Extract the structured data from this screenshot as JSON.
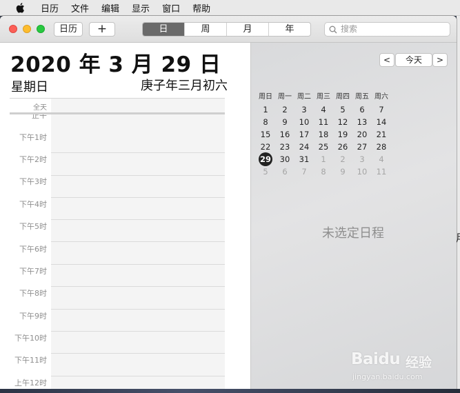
{
  "menubar": {
    "items": [
      "日历",
      "文件",
      "编辑",
      "显示",
      "窗口",
      "帮助"
    ]
  },
  "toolbar": {
    "calendars_label": "日历",
    "add_label": "+",
    "views": [
      {
        "label": "日",
        "active": true
      },
      {
        "label": "周",
        "active": false
      },
      {
        "label": "月",
        "active": false
      },
      {
        "label": "年",
        "active": false
      }
    ],
    "search_placeholder": "搜索"
  },
  "dayview": {
    "date_title": "2020 年 3 月 29 日",
    "weekday": "星期日",
    "lunar_date": "庚子年三月初六",
    "allday_label": "全天",
    "partial_label": "正午",
    "hours": [
      "下午1时",
      "下午2时",
      "下午3时",
      "下午4时",
      "下午5时",
      "下午6时",
      "下午7时",
      "下午8时",
      "下午9时",
      "下午10时",
      "下午11时",
      "上午12时"
    ]
  },
  "sidebar": {
    "prev_label": "<",
    "today_label": "今天",
    "next_label": ">",
    "weekday_headers": [
      "周日",
      "周一",
      "周二",
      "周三",
      "周四",
      "周五",
      "周六"
    ],
    "weeks": [
      [
        {
          "d": "1",
          "dim": false
        },
        {
          "d": "2",
          "dim": false
        },
        {
          "d": "3",
          "dim": false
        },
        {
          "d": "4",
          "dim": false
        },
        {
          "d": "5",
          "dim": false
        },
        {
          "d": "6",
          "dim": false
        },
        {
          "d": "7",
          "dim": false
        }
      ],
      [
        {
          "d": "8",
          "dim": false
        },
        {
          "d": "9",
          "dim": false
        },
        {
          "d": "10",
          "dim": false
        },
        {
          "d": "11",
          "dim": false
        },
        {
          "d": "12",
          "dim": false
        },
        {
          "d": "13",
          "dim": false
        },
        {
          "d": "14",
          "dim": false
        }
      ],
      [
        {
          "d": "15",
          "dim": false
        },
        {
          "d": "16",
          "dim": false
        },
        {
          "d": "17",
          "dim": false
        },
        {
          "d": "18",
          "dim": false
        },
        {
          "d": "19",
          "dim": false
        },
        {
          "d": "20",
          "dim": false
        },
        {
          "d": "21",
          "dim": false
        }
      ],
      [
        {
          "d": "22",
          "dim": false
        },
        {
          "d": "23",
          "dim": false
        },
        {
          "d": "24",
          "dim": false
        },
        {
          "d": "25",
          "dim": false
        },
        {
          "d": "26",
          "dim": false
        },
        {
          "d": "27",
          "dim": false
        },
        {
          "d": "28",
          "dim": false
        }
      ],
      [
        {
          "d": "29",
          "dim": false,
          "today": true
        },
        {
          "d": "30",
          "dim": false
        },
        {
          "d": "31",
          "dim": false
        },
        {
          "d": "1",
          "dim": true
        },
        {
          "d": "2",
          "dim": true
        },
        {
          "d": "3",
          "dim": true
        },
        {
          "d": "4",
          "dim": true
        }
      ],
      [
        {
          "d": "5",
          "dim": true
        },
        {
          "d": "6",
          "dim": true
        },
        {
          "d": "7",
          "dim": true
        },
        {
          "d": "8",
          "dim": true
        },
        {
          "d": "9",
          "dim": true
        },
        {
          "d": "10",
          "dim": true
        },
        {
          "d": "11",
          "dim": true
        }
      ]
    ],
    "no_event_text": "未选定日程"
  },
  "background": {
    "edge_glyph": "月"
  },
  "watermark": {
    "logo": "Baidu",
    "brand": "经验",
    "url": "jingyan.baidu.com"
  },
  "colors": {
    "close": "#fc5f57",
    "minimize": "#fdbd2e",
    "zoom": "#28c840",
    "selected_segment": "#6a6a6a",
    "today_circle": "#222222"
  }
}
